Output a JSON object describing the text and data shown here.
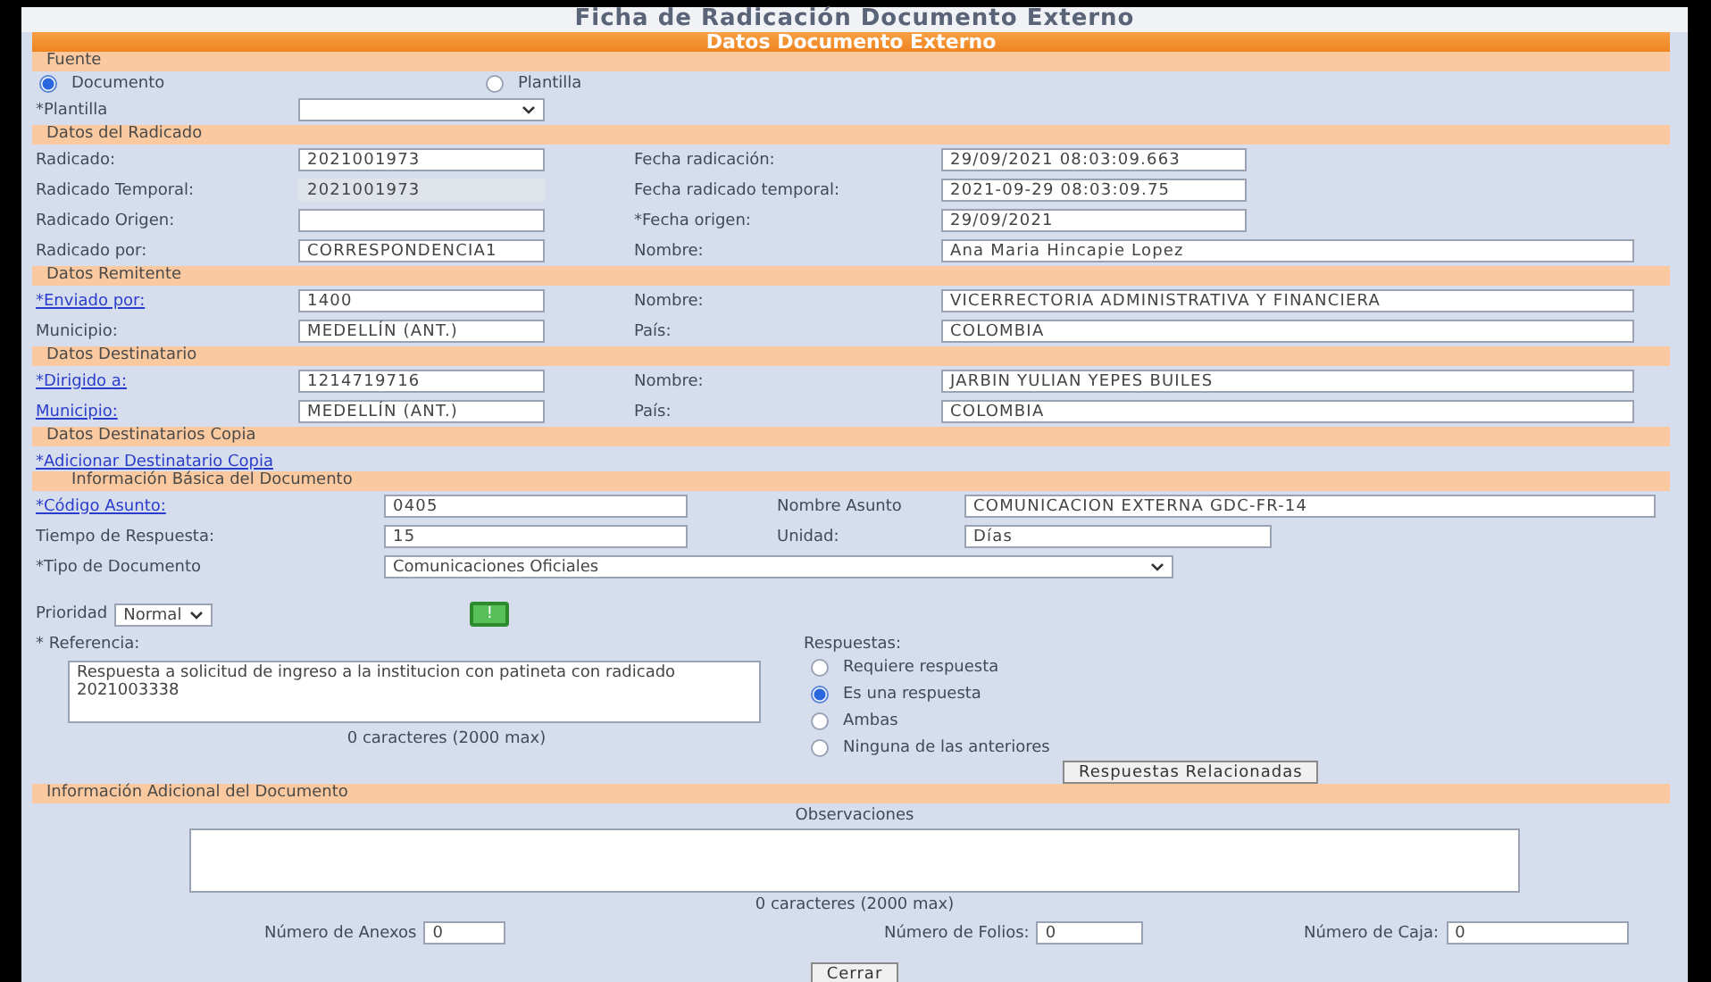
{
  "title": "Ficha de Radicación Documento Externo",
  "banner": "Datos Documento Externo",
  "fuente": {
    "heading": "Fuente",
    "options": [
      {
        "label": "Documento",
        "selected": true
      },
      {
        "label": "Plantilla",
        "selected": false
      }
    ],
    "template_label": "*Plantilla"
  },
  "sections": [
    {
      "heading": "Datos del Radicado",
      "rows": [
        [
          {
            "label": "Radicado:",
            "value": "2021001973"
          },
          {
            "label": "Fecha radicación:",
            "value": "29/09/2021 08:03:09.663",
            "wide": false
          }
        ],
        [
          {
            "label": "Radicado Temporal:",
            "value": "2021001973",
            "readonly": true
          },
          {
            "label": "Fecha radicado temporal:",
            "value": "2021-09-29 08:03:09.75",
            "wide": false
          }
        ],
        [
          {
            "label": "Radicado Origen:"
          },
          {
            "label": "*Fecha origen:",
            "value": "29/09/2021",
            "wide": false
          }
        ],
        [
          {
            "label": "Radicado por:",
            "value": "CORRESPONDENCIA1"
          },
          {
            "label": "Nombre:",
            "value": "Ana Maria Hincapie Lopez",
            "wide": true
          }
        ]
      ]
    },
    {
      "heading": "Datos Remitente",
      "rows": [
        [
          {
            "label": "*Enviado por:",
            "link": true,
            "value": "1400"
          },
          {
            "label": "Nombre:",
            "value": "VICERRECTORIA ADMINISTRATIVA Y FINANCIERA",
            "wide": true
          }
        ],
        [
          {
            "label": "Municipio:",
            "value": "MEDELLÍN (ANT.)"
          },
          {
            "label": "País:",
            "value": "COLOMBIA",
            "wide": true
          }
        ]
      ]
    },
    {
      "heading": "Datos Destinatario",
      "rows": [
        [
          {
            "label": "*Dirigido a:",
            "link": true,
            "value": "1214719716"
          },
          {
            "label": "Nombre:",
            "value": "JARBIN YULIAN YEPES BUILES",
            "wide": true
          }
        ],
        [
          {
            "label": "Municipio:",
            "link": true,
            "value": "MEDELLÍN (ANT.)"
          },
          {
            "label": "País:",
            "value": "COLOMBIA",
            "wide": true
          }
        ]
      ]
    }
  ],
  "copies": {
    "heading": "Datos Destinatarios Copia",
    "add_link": "*Adicionar Destinatario Copia"
  },
  "basic": {
    "heading": "Información Básica del Documento",
    "rows": [
      [
        {
          "label": "*Código Asunto:",
          "link": true,
          "value": "0405"
        },
        {
          "label": "Nombre Asunto",
          "value": "COMUNICACION EXTERNA GDC-FR-14",
          "wide": true
        }
      ],
      [
        {
          "label": "Tiempo de Respuesta:",
          "value": "15"
        },
        {
          "label": "Unidad:",
          "value": "Días",
          "wide": false
        }
      ]
    ],
    "type_label": "*Tipo de Documento",
    "type_value": "Comunicaciones Oficiales",
    "priority_label": "Prioridad",
    "priority_value": "Normal",
    "alert_button": "!",
    "reference_label": "* Referencia:",
    "reference_value": "Respuesta a solicitud de ingreso a la institucion con patineta con radicado 2021003338",
    "reference_counter": "0 caracteres (2000 max)",
    "answers_label": "Respuestas:",
    "answers": [
      {
        "label": "Requiere respuesta",
        "selected": false
      },
      {
        "label": "Es una respuesta",
        "selected": true
      },
      {
        "label": "Ambas",
        "selected": false
      },
      {
        "label": "Ninguna de las anteriores",
        "selected": false
      }
    ],
    "related_button": "Respuestas Relacionadas"
  },
  "additional": {
    "heading": "Información Adicional del Documento",
    "obs_label": "Observaciones",
    "obs_counter": "0 caracteres (2000 max)",
    "counts": [
      {
        "label": "Número de Anexos",
        "value": "0"
      },
      {
        "label": "Número de Folios:",
        "value": "0"
      },
      {
        "label": "Número de Caja:",
        "value": "0"
      }
    ]
  },
  "close_button": "Cerrar"
}
